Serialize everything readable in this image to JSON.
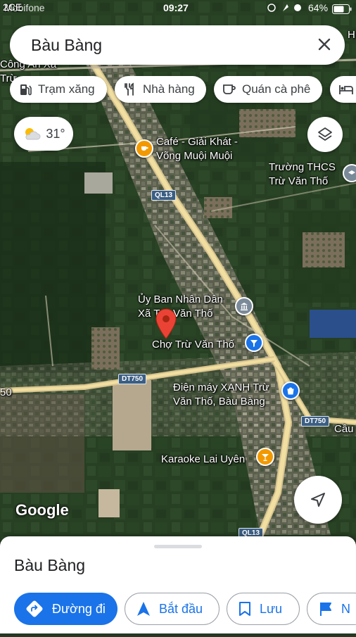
{
  "status_bar": {
    "carrier": "Mobifone",
    "time": "09:27",
    "battery": "64%"
  },
  "search": {
    "query": "Bàu Bàng"
  },
  "chips": [
    {
      "label": "Trạm xăng",
      "icon": "gas-station-icon"
    },
    {
      "label": "Nhà hàng",
      "icon": "restaurant-icon"
    },
    {
      "label": "Quán cà phê",
      "icon": "coffee-icon"
    },
    {
      "label": "",
      "icon": "hotel-icon"
    }
  ],
  "weather": {
    "temperature": "31°",
    "icon": "partly-cloudy-icon"
  },
  "map": {
    "road_shields": {
      "ql13_top": "QL13",
      "ql13_bottom": "QL13",
      "dt750_left": "DT750",
      "dt750_right": "DT750"
    },
    "labels": {
      "cong_an": "Công An Xã\nTrừ",
      "cafe": "Café - Giải Khát -\nVõng Muội Muội",
      "school": "Trường THCS\nTrừ Văn Thố",
      "ubnd": "Ủy Ban Nhân Dân\nXã Trừ Văn Thố",
      "cho": "Chợ Trừ Văn Thố",
      "dien_may": "Điện máy XANH Trừ\nVăn Thố, Bàu Bàng",
      "karaoke": "Karaoke Lai Uyên",
      "cau": "Cầu",
      "left_num": "50",
      "top_left": "2CE",
      "top_right": "H"
    },
    "poi_colors": {
      "food": "#f29900",
      "civic": "#7b8a99",
      "shopping": "#1a73e8",
      "pin": "#ea4335"
    },
    "logo": "Google"
  },
  "sheet": {
    "title": "Bàu Bàng",
    "actions": [
      {
        "label": "Đường đi",
        "icon": "directions-icon"
      },
      {
        "label": "Bắt đầu",
        "icon": "navigation-arrow-icon"
      },
      {
        "label": "Lưu",
        "icon": "bookmark-icon"
      },
      {
        "label": "N",
        "icon": "flag-icon"
      }
    ]
  }
}
